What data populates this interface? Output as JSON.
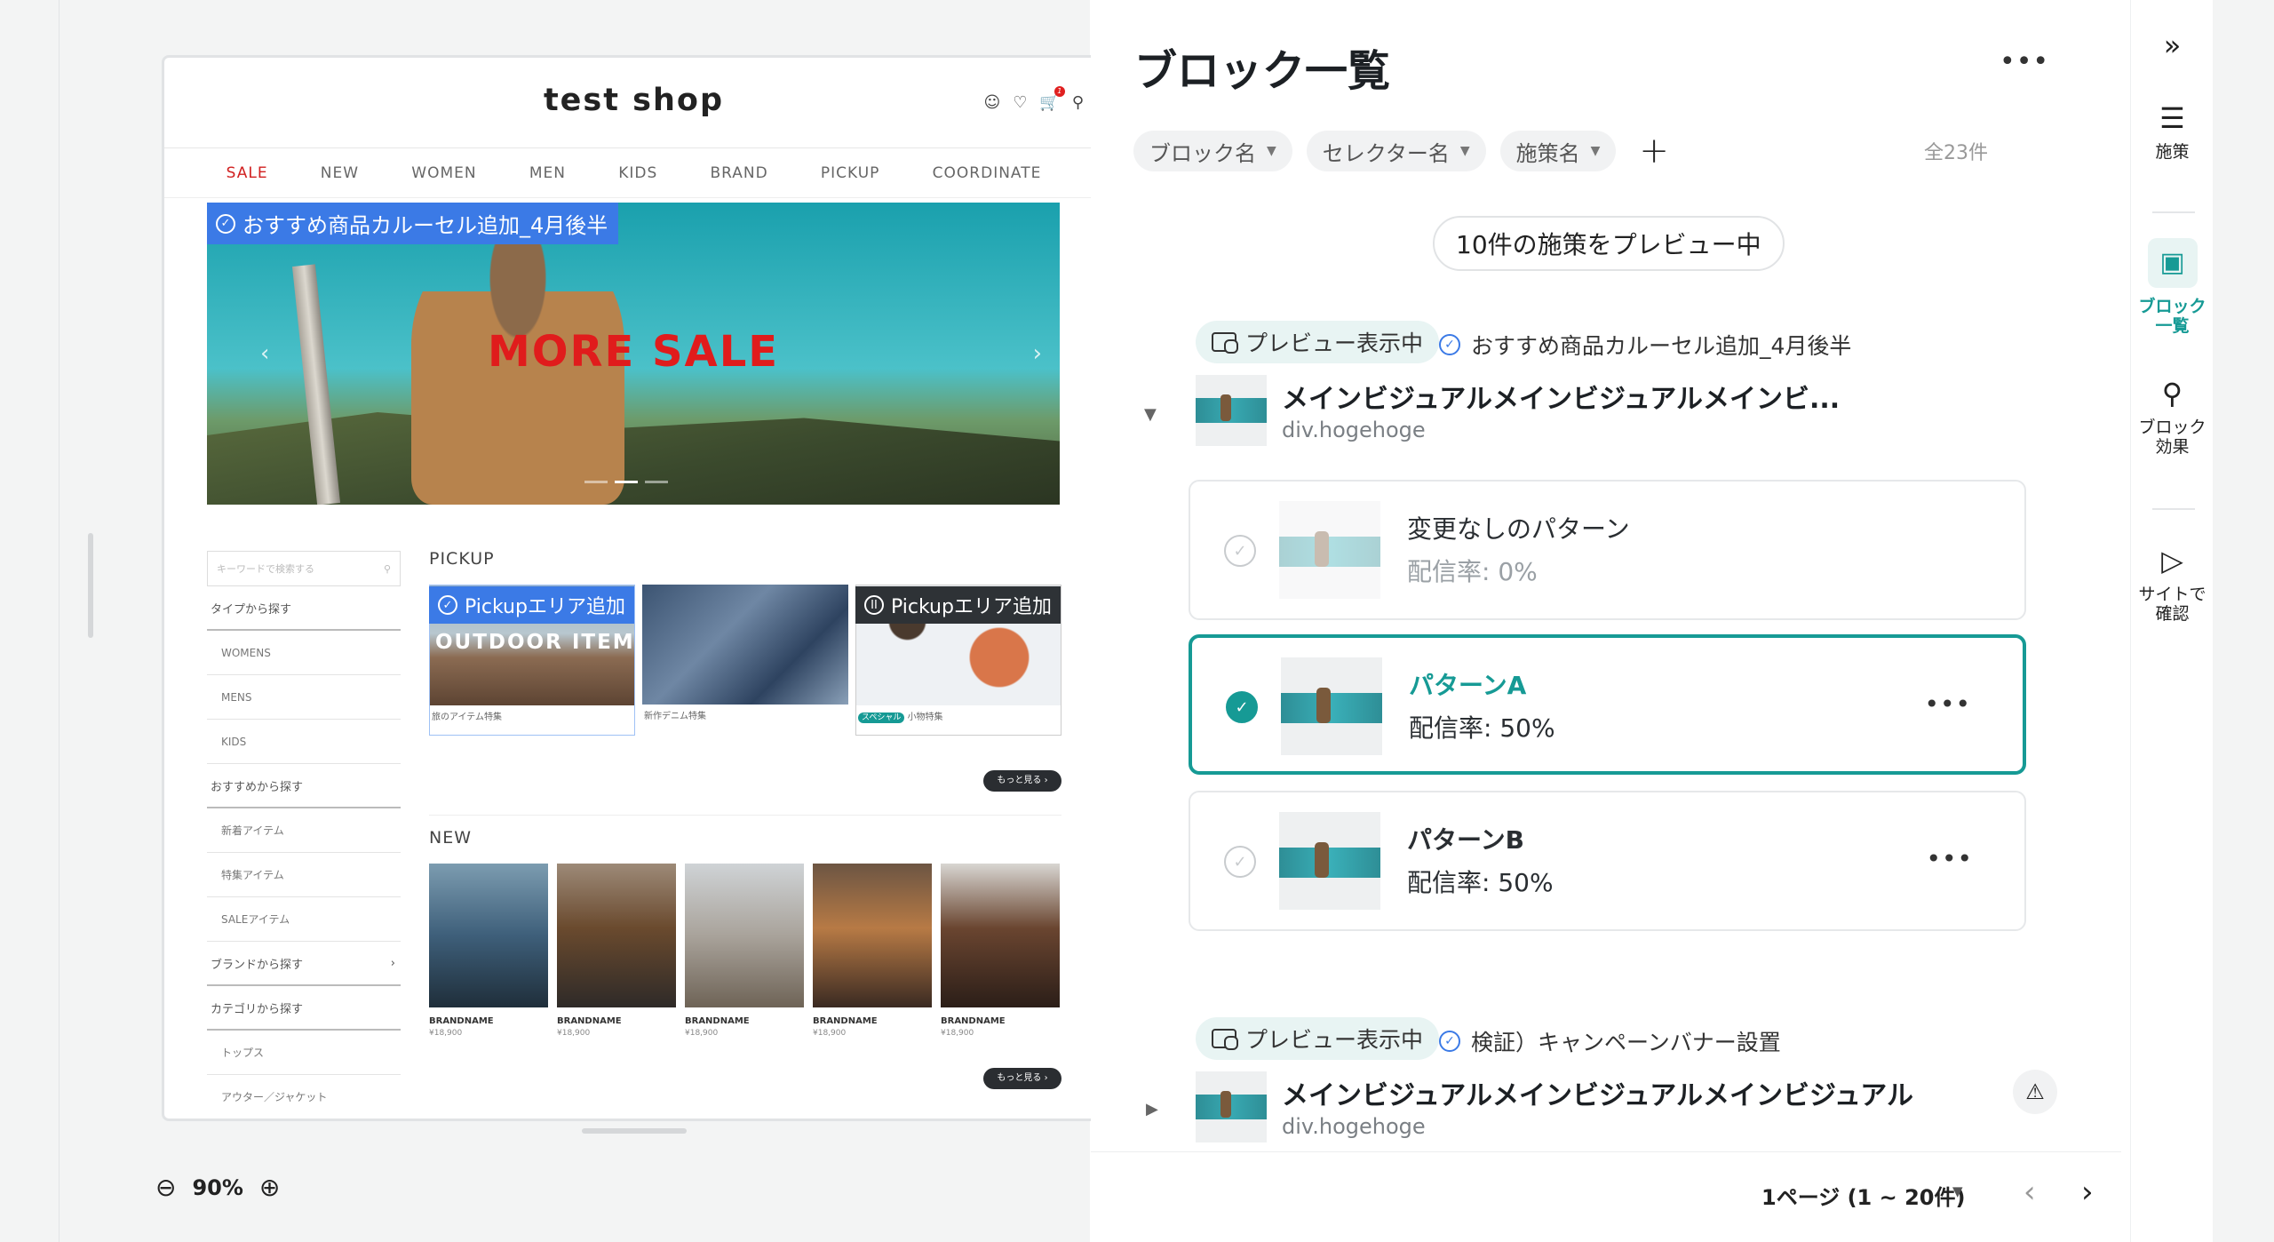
{
  "shop": {
    "title": "test shop",
    "nav": [
      "SALE",
      "NEW",
      "WOMEN",
      "MEN",
      "KIDS",
      "BRAND",
      "PICKUP",
      "COORDINATE"
    ],
    "hero_text": "MORE SALE",
    "hero_tag": "おすすめ商品カルーセル追加_4月後半",
    "search_placeholder": "キーワードで検索する",
    "side": [
      {
        "label": "タイプから探す",
        "type": "head"
      },
      {
        "label": "WOMENS",
        "type": "sub"
      },
      {
        "label": "MENS",
        "type": "sub"
      },
      {
        "label": "KIDS",
        "type": "sub"
      },
      {
        "label": "おすすめから探す",
        "type": "head"
      },
      {
        "label": "新着アイテム",
        "type": "sub"
      },
      {
        "label": "特集アイテム",
        "type": "sub"
      },
      {
        "label": "SALEアイテム",
        "type": "sub"
      },
      {
        "label": "ブランドから探す",
        "type": "head",
        "arrow": "›"
      },
      {
        "label": "カテゴリから探す",
        "type": "head"
      },
      {
        "label": "トップス",
        "type": "sub"
      },
      {
        "label": "アウター／ジャケット",
        "type": "sub"
      }
    ],
    "pickup_title": "PICKUP",
    "pickup": [
      {
        "tag": "Pickupエリア追加",
        "overlay": "OUTDOOR ITEM",
        "caption": "旅のアイテム特集"
      },
      {
        "caption": "新作デニム特集"
      },
      {
        "tag": "Pickupエリア追加",
        "special": "スペシャル",
        "caption": "小物特集"
      }
    ],
    "more_label": "もっと見る ›",
    "new_title": "NEW",
    "new_items": [
      {
        "brand": "BRANDNAME",
        "price": "¥18,900"
      },
      {
        "brand": "BRANDNAME",
        "price": "¥18,900"
      },
      {
        "brand": "BRANDNAME",
        "price": "¥18,900"
      },
      {
        "brand": "BRANDNAME",
        "price": "¥18,900"
      },
      {
        "brand": "BRANDNAME",
        "price": "¥18,900"
      }
    ]
  },
  "zoom": {
    "value": "90%"
  },
  "panel": {
    "title": "ブロック一覧",
    "filters": [
      "ブロック名",
      "セレクター名",
      "施策名"
    ],
    "count": "全23件",
    "preview_pill": "10件の施策をプレビュー中",
    "blocks": [
      {
        "badge": "プレビュー表示中",
        "campaign": "おすすめ商品カルーセル追加_4月後半",
        "name": "メインビジュアルメインビジュアルメインビ...",
        "selector": "div.hogehoge",
        "patterns": [
          {
            "name": "変更なしのパターン",
            "rate": "配信率: 0%"
          },
          {
            "name": "パターンA",
            "rate": "配信率: 50%"
          },
          {
            "name": "パターンB",
            "rate": "配信率: 50%"
          }
        ]
      },
      {
        "badge": "プレビュー表示中",
        "campaign": "検証）キャンペーンバナー設置",
        "name": "メインビジュアルメインビジュアルメインビジュアル",
        "selector": "div.hogehoge"
      }
    ],
    "pager": "1ページ (1 ~ 20件)"
  },
  "rail": {
    "items": [
      {
        "label": "施策"
      },
      {
        "label": "ブロック\n一覧"
      },
      {
        "label": "ブロック\n効果"
      },
      {
        "label": "サイトで\n確認"
      }
    ]
  },
  "colors": {
    "accent": "#169a95",
    "tag": "#3b7ae6",
    "sale": "#e01c1c"
  }
}
